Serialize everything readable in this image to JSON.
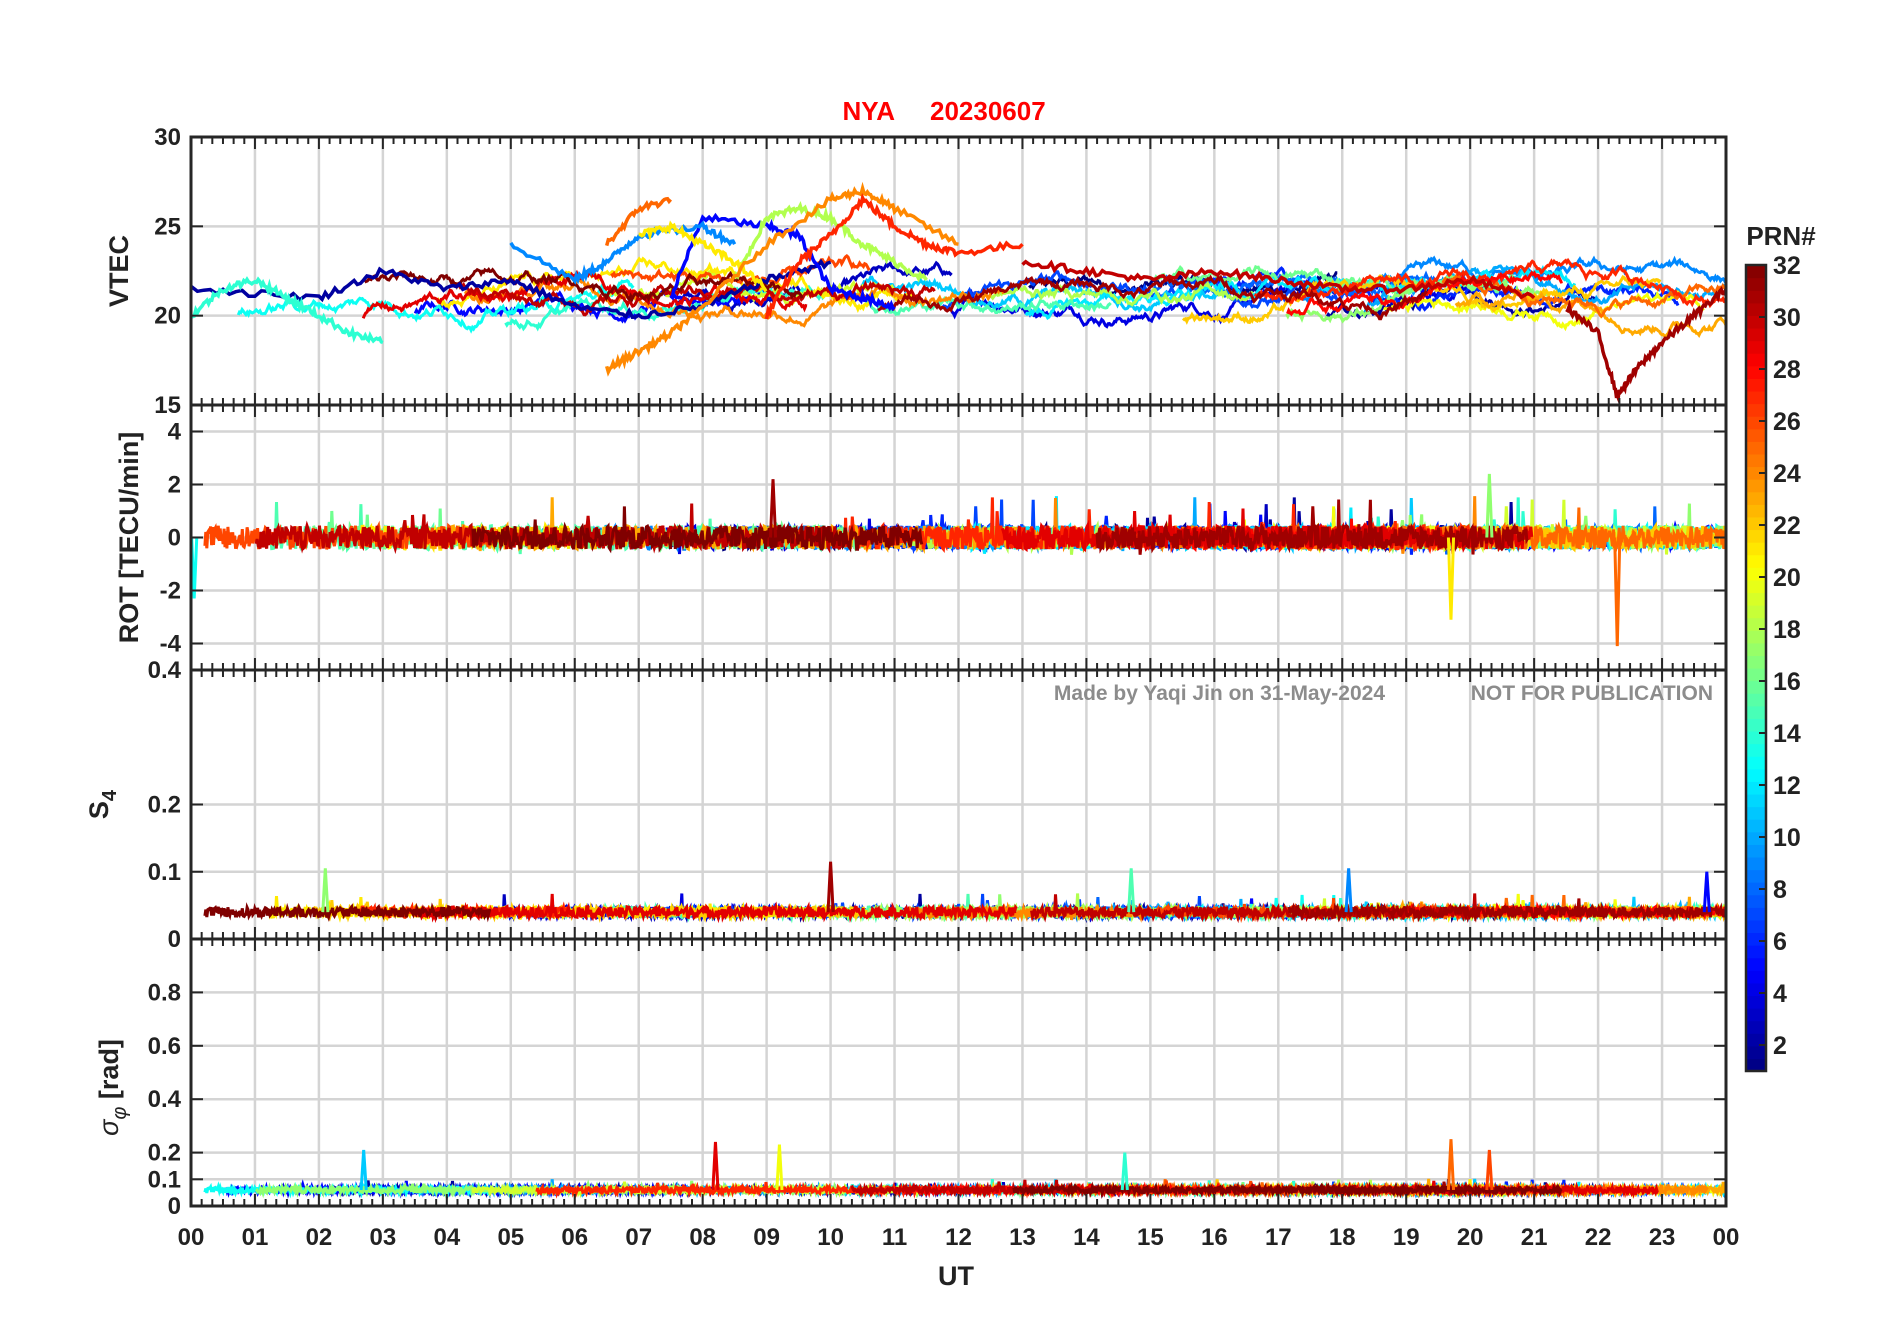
{
  "figure": {
    "title_station": "NYA",
    "title_date": "20230607",
    "title_color": "#ff0000",
    "xlabel": "UT",
    "xticklabels": [
      "00",
      "01",
      "02",
      "03",
      "04",
      "05",
      "06",
      "07",
      "08",
      "09",
      "10",
      "11",
      "12",
      "13",
      "14",
      "15",
      "16",
      "17",
      "18",
      "19",
      "20",
      "21",
      "22",
      "23",
      "00"
    ],
    "watermark_author": "Made by Yaqi Jin on 31-May-2024",
    "watermark_notice": "NOT FOR PUBLICATION",
    "watermark_color": "#8c8c8c"
  },
  "colorbar": {
    "label": "PRN#",
    "range": [
      1,
      32
    ],
    "ticks": [
      "2",
      "4",
      "6",
      "8",
      "10",
      "12",
      "14",
      "16",
      "18",
      "20",
      "22",
      "24",
      "26",
      "28",
      "30",
      "32"
    ],
    "colormap": "jet"
  },
  "chart_data": [
    {
      "type": "line",
      "panel": "vtec",
      "ylabel": "VTEC",
      "ylim": [
        15,
        30
      ],
      "yticks": [
        "15",
        "20",
        "25",
        "30"
      ],
      "xlim": [
        0,
        24
      ],
      "grid": true,
      "description_of_series": "one line per GPS satellite (PRN 1-32), colored by PRN",
      "series_samples": [
        {
          "prn": 2,
          "x": [
            0.0,
            2.0,
            3.0,
            4.0,
            5.0,
            6.0,
            7.0,
            8.0,
            9.0,
            10.0
          ],
          "y": [
            21.5,
            21.0,
            22.5,
            21.5,
            22.0,
            20.5,
            20.0,
            20.5,
            22.0,
            23.0
          ]
        },
        {
          "prn": 5,
          "x": [
            7.5,
            8.0,
            9.0,
            9.5,
            10.0,
            10.5,
            11.0
          ],
          "y": [
            21.0,
            25.5,
            25.0,
            24.5,
            21.5,
            21.0,
            20.5
          ]
        },
        {
          "prn": 9,
          "x": [
            5.0,
            6.0,
            6.5,
            7.0,
            8.0,
            8.5
          ],
          "y": [
            24.0,
            22.0,
            23.0,
            24.5,
            25.0,
            24.0
          ]
        },
        {
          "prn": 14,
          "x": [
            0.0,
            0.5,
            1.0,
            1.5,
            2.0,
            2.5,
            3.0
          ],
          "y": [
            20.0,
            21.5,
            22.0,
            21.0,
            20.0,
            19.0,
            18.5
          ]
        },
        {
          "prn": 18,
          "x": [
            8.5,
            9.0,
            9.5,
            10.0,
            10.5,
            11.0,
            11.5
          ],
          "y": [
            22.0,
            25.5,
            26.0,
            25.5,
            24.0,
            23.0,
            22.0
          ]
        },
        {
          "prn": 21,
          "x": [
            7.0,
            7.5,
            8.0,
            8.5,
            9.0
          ],
          "y": [
            24.5,
            25.0,
            24.0,
            23.0,
            21.5
          ]
        },
        {
          "prn": 24,
          "x": [
            6.5,
            7.0,
            7.5,
            8.0,
            9.0,
            10.0,
            10.5,
            11.0,
            12.0
          ],
          "y": [
            17.0,
            18.0,
            19.0,
            20.5,
            24.0,
            26.5,
            27.0,
            26.0,
            24.0
          ]
        },
        {
          "prn": 25,
          "x": [
            6.5,
            7.0,
            7.5
          ],
          "y": [
            24.0,
            26.0,
            26.5
          ]
        },
        {
          "prn": 27,
          "x": [
            9.0,
            9.5,
            10.0,
            10.5,
            11.0,
            11.5,
            12.0,
            13.0
          ],
          "y": [
            20.0,
            23.0,
            24.5,
            26.5,
            25.0,
            24.0,
            23.5,
            24.0
          ]
        },
        {
          "prn": 30,
          "x": [
            13.0,
            14.0,
            15.0,
            16.0,
            17.0,
            18.0,
            19.0,
            20.0,
            21.0
          ],
          "y": [
            23.0,
            22.5,
            22.0,
            22.5,
            22.0,
            21.5,
            21.5,
            22.0,
            21.0
          ]
        },
        {
          "prn": 31,
          "x": [
            21.5,
            22.0,
            22.3,
            22.6,
            23.0,
            23.5,
            24.0
          ],
          "y": [
            20.5,
            19.0,
            15.5,
            17.0,
            18.5,
            20.0,
            21.5
          ]
        }
      ]
    },
    {
      "type": "line",
      "panel": "rot",
      "ylabel": "ROT [TECU/min]",
      "ylim": [
        -5,
        5
      ],
      "yticks": [
        "-4",
        "-2",
        "0",
        "2",
        "4"
      ],
      "xlim": [
        0,
        24
      ],
      "grid": true,
      "description_of_series": "one line per GPS satellite (PRN 1-32), colored by PRN; values mostly within ±1 TECU/min",
      "notable_points": [
        {
          "x": 9.1,
          "y": 2.2
        },
        {
          "x": 19.7,
          "y": -3.1
        },
        {
          "x": 20.3,
          "y": 2.4
        },
        {
          "x": 22.3,
          "y": -4.1
        },
        {
          "x": 0.05,
          "y": -2.3
        }
      ]
    },
    {
      "type": "line",
      "panel": "s4",
      "ylabel": "S4",
      "ylim": [
        0,
        0.4
      ],
      "yticks": [
        "0",
        "0.1",
        "0.2",
        "0.4"
      ],
      "xlim": [
        0,
        24
      ],
      "grid": true,
      "description_of_series": "one line per GPS satellite (PRN 1-32), colored by PRN; baseline around 0.04",
      "notable_points": [
        {
          "x": 2.1,
          "y": 0.105
        },
        {
          "x": 10.0,
          "y": 0.115
        },
        {
          "x": 14.7,
          "y": 0.105
        },
        {
          "x": 18.1,
          "y": 0.105
        },
        {
          "x": 23.7,
          "y": 0.1
        }
      ]
    },
    {
      "type": "line",
      "panel": "sigma_phi",
      "ylabel": "σφ [rad]",
      "ylim": [
        0,
        1
      ],
      "yticks": [
        "0",
        "0.1",
        "0.2",
        "0.4",
        "0.6",
        "0.8"
      ],
      "xlim": [
        0,
        24
      ],
      "grid": true,
      "description_of_series": "one line per GPS satellite (PRN 1-32), colored by PRN; baseline around 0.06",
      "notable_points": [
        {
          "x": 2.7,
          "y": 0.21
        },
        {
          "x": 8.2,
          "y": 0.24
        },
        {
          "x": 9.2,
          "y": 0.23
        },
        {
          "x": 14.6,
          "y": 0.2
        },
        {
          "x": 19.7,
          "y": 0.25
        },
        {
          "x": 20.3,
          "y": 0.21
        }
      ]
    }
  ]
}
